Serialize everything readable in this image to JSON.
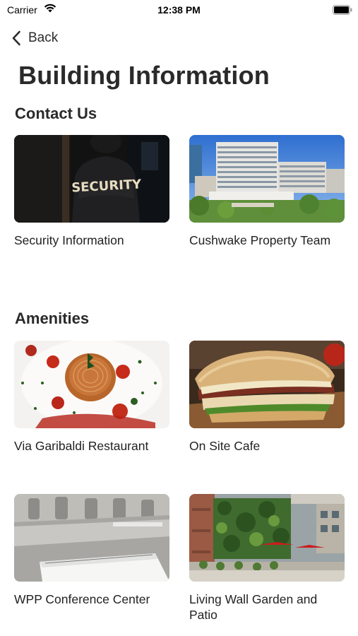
{
  "status_bar": {
    "carrier": "Carrier",
    "time": "12:38 PM",
    "icons": [
      "wifi-icon",
      "battery-icon"
    ]
  },
  "nav": {
    "back_label": "Back",
    "back_icon": "chevron-left-icon"
  },
  "page": {
    "title": "Building Information"
  },
  "sections": {
    "contact": {
      "title": "Contact Us",
      "cards": [
        {
          "label": "Security Information"
        },
        {
          "label": "Cushwake Property Team"
        }
      ]
    },
    "amenities": {
      "title": "Amenities",
      "cards": [
        {
          "label": "Via Garibaldi Restaurant"
        },
        {
          "label": "On Site Cafe"
        },
        {
          "label": "WPP Conference Center"
        },
        {
          "label": "Living Wall Garden and Patio"
        }
      ]
    }
  },
  "photo_text": {
    "security_jacket": "SECURITY"
  },
  "colors": {
    "background": "#ffffff",
    "text_primary": "#2a2a2a"
  }
}
